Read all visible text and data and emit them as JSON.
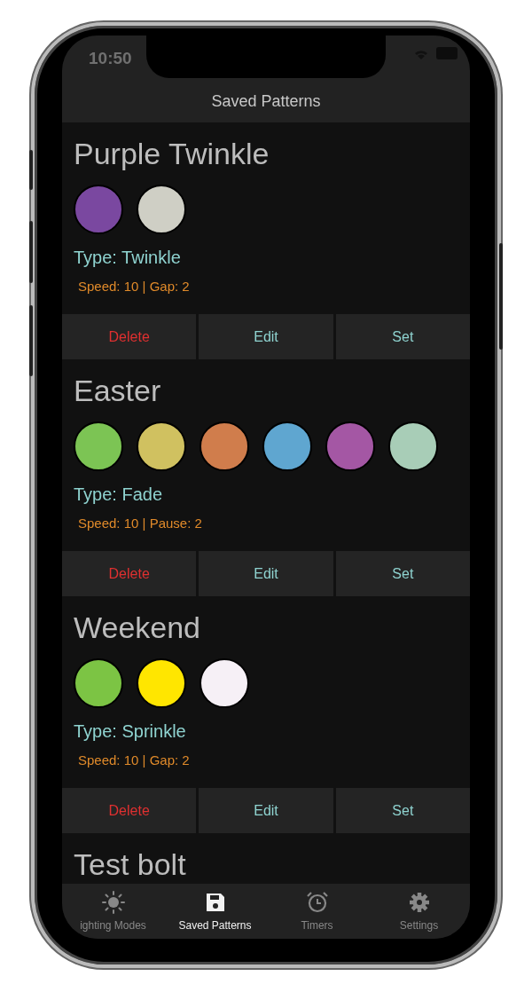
{
  "status_bar": {
    "time": "10:50"
  },
  "header": {
    "title": "Saved Patterns"
  },
  "patterns": [
    {
      "name": "Purple Twinkle",
      "colors": [
        {
          "color": "#7a48a0"
        },
        {
          "color": "#cfcfc5"
        }
      ],
      "type": "Type: Twinkle",
      "details": "Speed: 10 | Gap: 2",
      "actions": [
        {
          "label": "Delete",
          "kind": "delete"
        },
        {
          "label": "Edit",
          "kind": "edit"
        },
        {
          "label": "Set",
          "kind": "set"
        }
      ]
    },
    {
      "name": "Easter",
      "colors": [
        {
          "color": "#7cc454"
        },
        {
          "color": "#d0c160"
        },
        {
          "color": "#d07d4c"
        },
        {
          "color": "#5fa6d0"
        },
        {
          "color": "#a457a4"
        },
        {
          "color": "#a8cdb7"
        }
      ],
      "type": "Type: Fade",
      "details": "Speed: 10 | Pause: 2",
      "actions": [
        {
          "label": "Delete",
          "kind": "delete"
        },
        {
          "label": "Edit",
          "kind": "edit"
        },
        {
          "label": "Set",
          "kind": "set"
        }
      ]
    },
    {
      "name": "Weekend",
      "colors": [
        {
          "color": "#7cc444"
        },
        {
          "color": "#ffe600"
        },
        {
          "color": "#f6f0f6"
        }
      ],
      "type": "Type: Sprinkle",
      "details": "Speed: 10 | Gap: 2",
      "actions": [
        {
          "label": "Delete",
          "kind": "delete"
        },
        {
          "label": "Edit",
          "kind": "edit"
        },
        {
          "label": "Set",
          "kind": "set"
        }
      ]
    },
    {
      "name": "Test bolt"
    }
  ],
  "tab_bar": [
    {
      "label": "ighting Modes",
      "kind": "sun",
      "selected": false
    },
    {
      "label": "Saved Patterns",
      "kind": "save",
      "selected": true
    },
    {
      "label": "Timers",
      "kind": "alarm",
      "selected": false
    },
    {
      "label": "Settings",
      "kind": "gear",
      "selected": false
    }
  ]
}
